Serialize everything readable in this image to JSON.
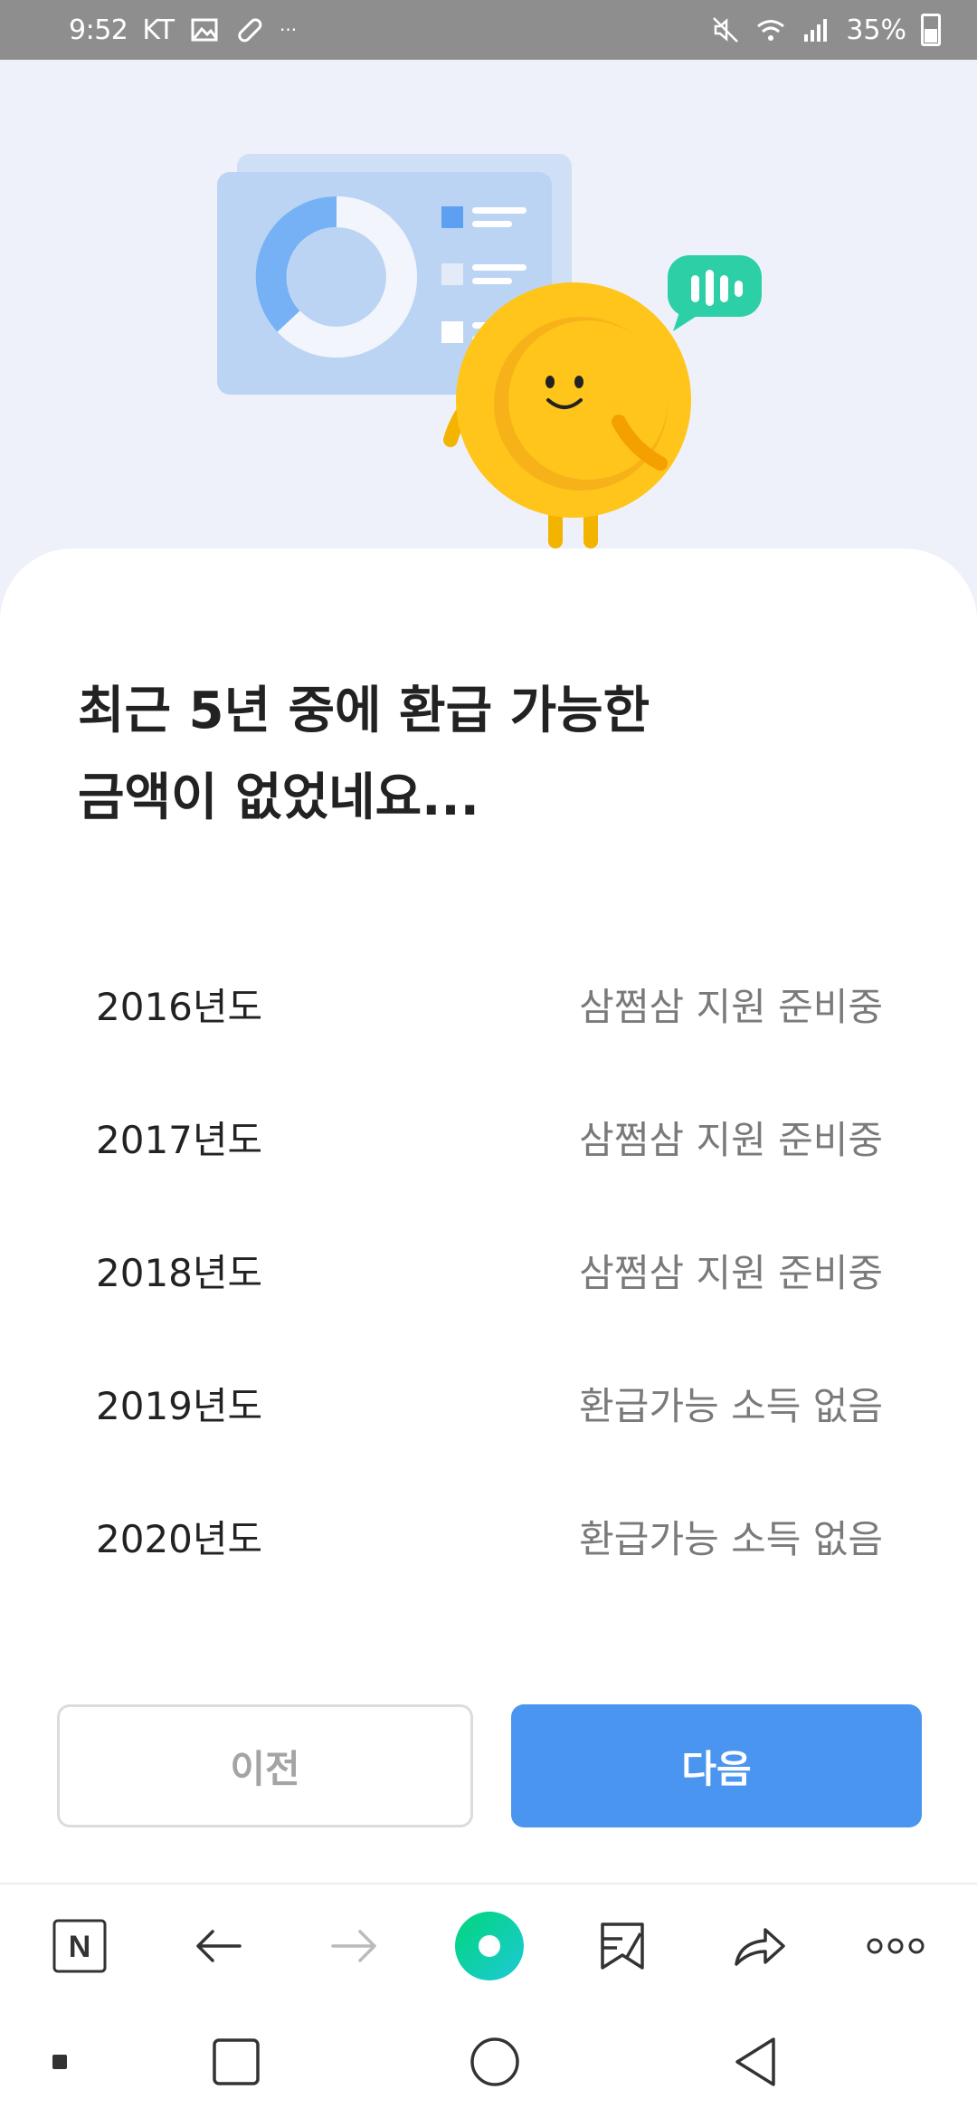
{
  "status_bar": {
    "time": "9:52",
    "carrier": "KT",
    "more": "···",
    "battery": "35%"
  },
  "headline": "최근 5년 중에 환급 가능한\n금액이 없었네요...",
  "years": [
    {
      "year": "2016년도",
      "status": "삼쩜삼 지원 준비중"
    },
    {
      "year": "2017년도",
      "status": "삼쩜삼 지원 준비중"
    },
    {
      "year": "2018년도",
      "status": "삼쩜삼 지원 준비중"
    },
    {
      "year": "2019년도",
      "status": "환급가능 소득 없음"
    },
    {
      "year": "2020년도",
      "status": "환급가능 소득 없음"
    }
  ],
  "buttons": {
    "prev": "이전",
    "next": "다음"
  },
  "browser_toolbar": {
    "logo": "N",
    "icons": [
      "naver-logo-icon",
      "back-arrow-icon",
      "forward-arrow-icon",
      "green-dot-icon",
      "bookmark-icon",
      "share-icon",
      "more-icon"
    ]
  },
  "colors": {
    "primary": "#4a95ef",
    "background": "#eff1fa",
    "coin": "#ffc51a",
    "chat_bubble": "#2dd0a6"
  }
}
